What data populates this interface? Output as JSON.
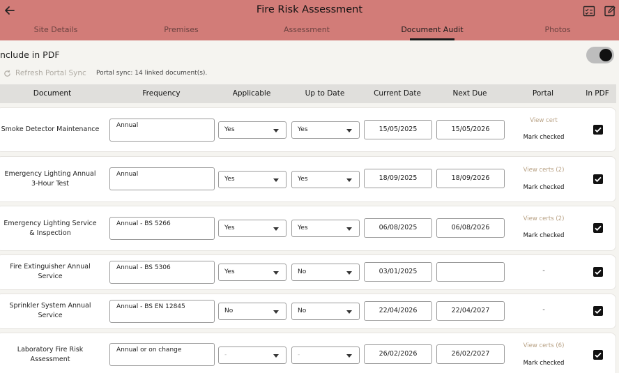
{
  "header": {
    "title": "Fire Risk Assessment",
    "tabs": [
      "Site Details",
      "Premises",
      "Assessment",
      "Document Audit",
      "Photos"
    ],
    "active_tab": "Document Audit"
  },
  "toolbar": {
    "include_pdf_label": "nclude in PDF",
    "refresh_label": "Refresh Portal Sync",
    "sync_status": "Portal sync: 14 linked document(s)."
  },
  "table": {
    "columns": [
      "Document",
      "Frequency",
      "Applicable",
      "Up to Date",
      "Current Date",
      "Next Due",
      "Portal",
      "In PDF"
    ],
    "rows": [
      {
        "document": "Smoke Detector Maintenance",
        "frequency": "Annual",
        "applicable": "Yes",
        "up_to_date": "Yes",
        "current_date": "15/05/2025",
        "next_due": "15/05/2026",
        "portal_link": "View cert",
        "portal_mark": "Mark checked",
        "portal_dash": ""
      },
      {
        "document": "Emergency Lighting Annual 3-Hour Test",
        "frequency": "Annual",
        "applicable": "Yes",
        "up_to_date": "Yes",
        "current_date": "18/09/2025",
        "next_due": "18/09/2026",
        "portal_link": "View certs (2)",
        "portal_mark": "Mark checked",
        "portal_dash": ""
      },
      {
        "document": "Emergency Lighting Service & Inspection",
        "frequency": "Annual - BS 5266",
        "applicable": "Yes",
        "up_to_date": "Yes",
        "current_date": "06/08/2025",
        "next_due": "06/08/2026",
        "portal_link": "View certs (2)",
        "portal_mark": "Mark checked",
        "portal_dash": ""
      },
      {
        "document": "Fire Extinguisher Annual Service",
        "frequency": "Annual - BS 5306",
        "applicable": "Yes",
        "up_to_date": "No",
        "current_date": "03/01/2025",
        "next_due": "",
        "portal_link": "",
        "portal_mark": "",
        "portal_dash": "-"
      },
      {
        "document": "Sprinkler System Annual Service",
        "frequency": "Annual - BS EN 12845",
        "applicable": "No",
        "up_to_date": "No",
        "current_date": "22/04/2026",
        "next_due": "22/04/2027",
        "portal_link": "",
        "portal_mark": "",
        "portal_dash": "-"
      },
      {
        "document": "Laboratory Fire Risk Assessment",
        "frequency": "Annual or on change",
        "applicable": "-",
        "up_to_date": "-",
        "current_date": "26/02/2026",
        "next_due": "26/02/2027",
        "portal_link": "View certs (6)",
        "portal_mark": "Mark checked",
        "portal_dash": ""
      }
    ]
  },
  "colors": {
    "appbar": "#d27c78",
    "background": "#f5f4f0",
    "portal_link": "#b8a184",
    "checkbox": "#111111"
  }
}
